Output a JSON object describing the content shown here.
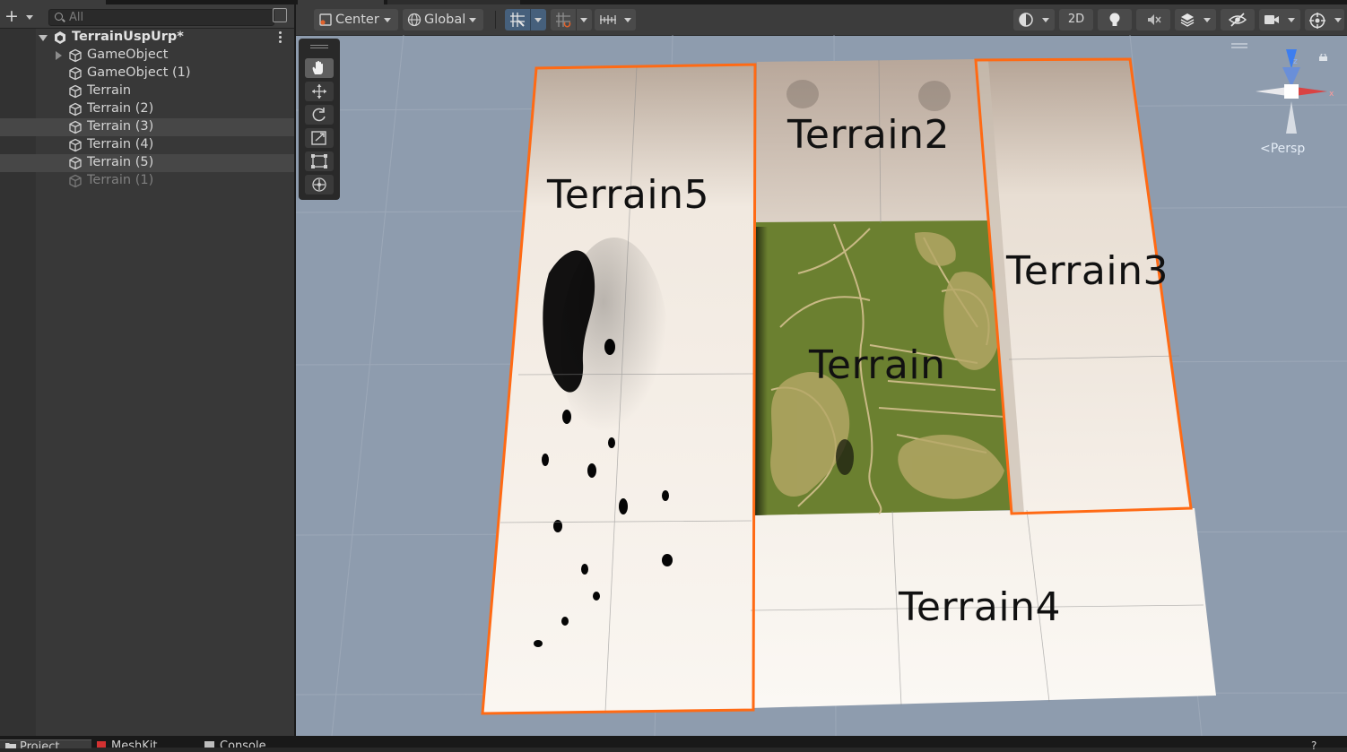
{
  "hierarchy": {
    "search_placeholder": "All",
    "scene_name": "TerrainUspUrp*",
    "items": [
      {
        "label": "GameObject",
        "has_children": true,
        "selected": false,
        "disabled": false
      },
      {
        "label": "GameObject (1)",
        "has_children": false,
        "selected": false,
        "disabled": false
      },
      {
        "label": "Terrain",
        "has_children": false,
        "selected": false,
        "disabled": false
      },
      {
        "label": "Terrain (2)",
        "has_children": false,
        "selected": false,
        "disabled": false
      },
      {
        "label": "Terrain (3)",
        "has_children": false,
        "selected": true,
        "disabled": false
      },
      {
        "label": "Terrain (4)",
        "has_children": false,
        "selected": false,
        "disabled": false
      },
      {
        "label": "Terrain (5)",
        "has_children": false,
        "selected": true,
        "disabled": false
      },
      {
        "label": "Terrain (1)",
        "has_children": false,
        "selected": false,
        "disabled": true
      }
    ]
  },
  "scene_toolbar": {
    "pivot_mode": "Center",
    "pivot_rotation": "Global",
    "mode_2d": "2D",
    "view_mode": "Persp"
  },
  "scene_labels": {
    "terrain5": "Terrain5",
    "terrain2": "Terrain2",
    "terrain3": "Terrain3",
    "terrain": "Terrain",
    "terrain4": "Terrain4"
  },
  "bottom_tabs": [
    "Project",
    "MeshKit",
    "Console"
  ],
  "colors": {
    "selection_outline": "#ff6a14",
    "terrain_green": "#6b8030",
    "terrain_beige": "#f6efe6",
    "scene_background": "#8e9cae",
    "toolbar_active": "#46607c"
  }
}
